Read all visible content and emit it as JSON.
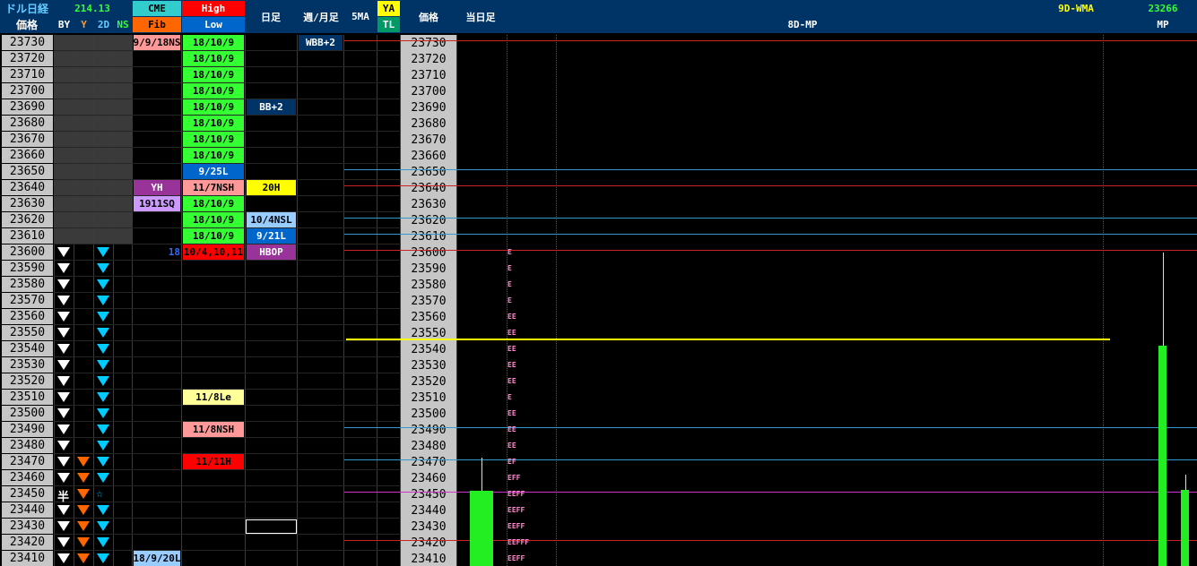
{
  "header": {
    "row1": [
      {
        "key": "usd_nikkei",
        "label": "ドル日経",
        "color": "#66ccff"
      },
      {
        "key": "usd_value",
        "label": "214.13",
        "color": "#33ff33"
      },
      {
        "key": "cme",
        "label": "CME",
        "color": "#000000",
        "bg": "#33cccc"
      },
      {
        "key": "high",
        "label": "High",
        "color": "#ffffff",
        "bg": "#ff0000"
      },
      {
        "key": "daily",
        "label": "日足",
        "color": "#ffffff"
      },
      {
        "key": "weekly_monthly",
        "label": "週/月足",
        "color": "#ffffff"
      },
      {
        "key": "five_ma",
        "label": "5MA",
        "color": "#ffffff"
      },
      {
        "key": "ya",
        "label": "YA",
        "color": "#000000",
        "bg": "#ffff00"
      },
      {
        "key": "price2",
        "label": "価格",
        "color": "#ffffff"
      },
      {
        "key": "today",
        "label": "当日足",
        "color": "#ffffff"
      },
      {
        "key": "wma",
        "label": "9D-WMA",
        "color": "#ffff00"
      },
      {
        "key": "wma_value",
        "label": "23266",
        "color": "#33ff33"
      }
    ],
    "row2": [
      {
        "key": "price",
        "label": "価格",
        "color": "#ffffff"
      },
      {
        "key": "by",
        "label": "BY",
        "color": "#ffffff"
      },
      {
        "key": "y",
        "label": "Y",
        "color": "#ff9933"
      },
      {
        "key": "twod",
        "label": "2D",
        "color": "#66ccff"
      },
      {
        "key": "ns",
        "label": "NS",
        "color": "#33ff33"
      },
      {
        "key": "fib",
        "label": "Fib",
        "color": "#000000",
        "bg": "#ff6600"
      },
      {
        "key": "low",
        "label": "Low",
        "color": "#ffffff",
        "bg": "#0066cc"
      },
      {
        "key": "tl",
        "label": "TL",
        "color": "#ffffff",
        "bg": "#009966"
      },
      {
        "key": "mp8d",
        "label": "8D-MP",
        "color": "#ffffff"
      },
      {
        "key": "mp",
        "label": "MP",
        "color": "#ffffff"
      }
    ]
  },
  "prices": [
    23730,
    23720,
    23710,
    23700,
    23690,
    23680,
    23670,
    23660,
    23650,
    23640,
    23630,
    23620,
    23610,
    23600,
    23590,
    23580,
    23570,
    23560,
    23550,
    23540,
    23530,
    23520,
    23510,
    23500,
    23490,
    23480,
    23470,
    23460,
    23450,
    23440,
    23430,
    23420,
    23410
  ],
  "markers": {
    "by_rows": [
      13,
      14,
      15,
      16,
      17,
      18,
      19,
      20,
      21,
      22,
      23,
      24,
      25,
      26,
      27,
      29,
      30,
      31,
      32
    ],
    "by_half_row": 28,
    "by_half_label": "半",
    "y_rows": [
      26,
      27,
      28,
      29,
      30,
      31,
      32
    ],
    "twod_rows": [
      13,
      14,
      15,
      16,
      17,
      18,
      19,
      20,
      21,
      22,
      23,
      24,
      25,
      26,
      27,
      29,
      30,
      31,
      32
    ],
    "twod_star_row": 28,
    "twod_star_label": "☆"
  },
  "tags": [
    {
      "col": "cme",
      "row": 0,
      "label": "9/9/18NS",
      "bg": "#ff9999",
      "color": "#000000"
    },
    {
      "col": "cme",
      "row": 9,
      "label": "YH",
      "bg": "#993399",
      "color": "#ffffff"
    },
    {
      "col": "cme",
      "row": 10,
      "label": "1911SQ",
      "bg": "#cc99ff",
      "color": "#000000"
    },
    {
      "col": "cme",
      "row": 13,
      "label": "18",
      "bg": "#000000",
      "color": "#3366ff"
    },
    {
      "col": "cme",
      "row": 32,
      "label": "18/9/20L",
      "bg": "#99ccff",
      "color": "#000000"
    },
    {
      "col": "hl",
      "row": 0,
      "label": "18/10/9",
      "bg": "#33ff33",
      "color": "#000000"
    },
    {
      "col": "hl",
      "row": 1,
      "label": "18/10/9",
      "bg": "#33ff33",
      "color": "#000000"
    },
    {
      "col": "hl",
      "row": 2,
      "label": "18/10/9",
      "bg": "#33ff33",
      "color": "#000000"
    },
    {
      "col": "hl",
      "row": 3,
      "label": "18/10/9",
      "bg": "#33ff33",
      "color": "#000000"
    },
    {
      "col": "hl",
      "row": 4,
      "label": "18/10/9",
      "bg": "#33ff33",
      "color": "#000000"
    },
    {
      "col": "hl",
      "row": 5,
      "label": "18/10/9",
      "bg": "#33ff33",
      "color": "#000000"
    },
    {
      "col": "hl",
      "row": 6,
      "label": "18/10/9",
      "bg": "#33ff33",
      "color": "#000000"
    },
    {
      "col": "hl",
      "row": 7,
      "label": "18/10/9",
      "bg": "#33ff33",
      "color": "#000000"
    },
    {
      "col": "hl",
      "row": 8,
      "label": "9/25L",
      "bg": "#0066cc",
      "color": "#ffffff"
    },
    {
      "col": "hl",
      "row": 9,
      "label": "11/7NSH",
      "bg": "#ff9999",
      "color": "#000000"
    },
    {
      "col": "hl",
      "row": 10,
      "label": "18/10/9",
      "bg": "#33ff33",
      "color": "#000000"
    },
    {
      "col": "hl",
      "row": 11,
      "label": "18/10/9",
      "bg": "#33ff33",
      "color": "#000000"
    },
    {
      "col": "hl",
      "row": 12,
      "label": "18/10/9",
      "bg": "#33ff33",
      "color": "#000000"
    },
    {
      "col": "hl",
      "row": 13,
      "label": "10/4,10,11",
      "bg": "#ff0000",
      "color": "#000000"
    },
    {
      "col": "hl",
      "row": 22,
      "label": "11/8Le",
      "bg": "#ffff99",
      "color": "#000000"
    },
    {
      "col": "hl",
      "row": 24,
      "label": "11/8NSH",
      "bg": "#ff9999",
      "color": "#000000"
    },
    {
      "col": "hl",
      "row": 26,
      "label": "11/11H",
      "bg": "#ff0000",
      "color": "#000000"
    },
    {
      "col": "daily",
      "row": 4,
      "label": "BB+2",
      "bg": "#003366",
      "color": "#ffffff"
    },
    {
      "col": "daily",
      "row": 9,
      "label": "20H",
      "bg": "#ffff00",
      "color": "#000000"
    },
    {
      "col": "daily",
      "row": 11,
      "label": "10/4NSL",
      "bg": "#99ccff",
      "color": "#000000"
    },
    {
      "col": "daily",
      "row": 12,
      "label": "9/21L",
      "bg": "#0066cc",
      "color": "#ffffff"
    },
    {
      "col": "daily",
      "row": 13,
      "label": "HBOP",
      "bg": "#993399",
      "color": "#ffffff"
    },
    {
      "col": "weekly",
      "row": 0,
      "label": "WBB+2",
      "bg": "#003366",
      "color": "#ffffff"
    }
  ],
  "levels": [
    {
      "row": 0,
      "color": "#cc2222"
    },
    {
      "row": 8,
      "color": "#3399cc"
    },
    {
      "row": 9,
      "color": "#cc2222"
    },
    {
      "row": 11,
      "color": "#3399cc"
    },
    {
      "row": 12,
      "color": "#3399cc"
    },
    {
      "row": 13,
      "color": "#cc2222"
    },
    {
      "row": 24,
      "color": "#3399cc"
    },
    {
      "row": 26,
      "color": "#3399cc"
    },
    {
      "row": 28,
      "color": "#cc33cc"
    },
    {
      "row": 31,
      "color": "#cc2222"
    }
  ],
  "yellow_level": {
    "row": 19,
    "color": "#ffff00"
  },
  "tpo": [
    {
      "row": 13,
      "text": "E"
    },
    {
      "row": 14,
      "text": "E"
    },
    {
      "row": 15,
      "text": "E"
    },
    {
      "row": 16,
      "text": "E"
    },
    {
      "row": 17,
      "text": "EE"
    },
    {
      "row": 18,
      "text": "EE"
    },
    {
      "row": 19,
      "text": "EE"
    },
    {
      "row": 20,
      "text": "EE"
    },
    {
      "row": 21,
      "text": "EE"
    },
    {
      "row": 22,
      "text": "E"
    },
    {
      "row": 23,
      "text": "EE"
    },
    {
      "row": 24,
      "text": "EE"
    },
    {
      "row": 25,
      "text": "EE"
    },
    {
      "row": 26,
      "text": "EF"
    },
    {
      "row": 27,
      "text": "EFF"
    },
    {
      "row": 28,
      "text": "EEFF"
    },
    {
      "row": 29,
      "text": "EEFF"
    },
    {
      "row": 30,
      "text": "EEFF"
    },
    {
      "row": 31,
      "text": "EEFFF"
    },
    {
      "row": 32,
      "text": "EEFF"
    }
  ],
  "candles": [
    {
      "name": "today-candle",
      "open": 23452,
      "close": 23405,
      "high": 23473,
      "low": 23405
    },
    {
      "name": "mp-candle-1",
      "open": 23542,
      "close": 23405,
      "high": 23600,
      "low": 23405
    },
    {
      "name": "mp-candle-2",
      "open": 23453,
      "close": 23405,
      "high": 23462,
      "low": 23405
    }
  ]
}
